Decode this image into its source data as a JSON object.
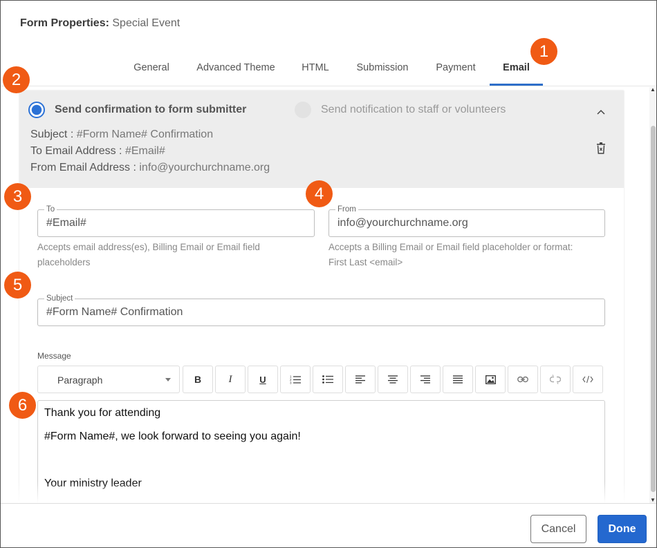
{
  "dialog": {
    "title_label": "Form Properties:",
    "title_name": "Special Event"
  },
  "tabs": [
    {
      "label": "General"
    },
    {
      "label": "Advanced Theme"
    },
    {
      "label": "HTML"
    },
    {
      "label": "Submission"
    },
    {
      "label": "Payment"
    },
    {
      "label": "Email",
      "active": true
    }
  ],
  "callouts": [
    "1",
    "2",
    "3",
    "4",
    "5",
    "6"
  ],
  "summary": {
    "option_selected": "Send confirmation to form submitter",
    "option_other": "Send notification to staff or volunteers",
    "subject_label": "Subject : ",
    "subject_value": "#Form Name# Confirmation",
    "to_label": "To Email Address : ",
    "to_value": "#Email#",
    "from_label": "From Email Address : ",
    "from_value": "info@yourchurchname.org"
  },
  "fields": {
    "to": {
      "label": "To",
      "value": "#Email#",
      "hint_line1": "Accepts email address(es), Billing Email or Email field",
      "hint_line2": "placeholders"
    },
    "from": {
      "label": "From",
      "value": "info@yourchurchname.org",
      "hint_line1": "Accepts a Billing Email or Email field placeholder or format:",
      "hint_line2": "First Last <email>"
    },
    "subject": {
      "label": "Subject",
      "value": "#Form Name# Confirmation"
    }
  },
  "message": {
    "label": "Message",
    "format_select": "Paragraph",
    "toolbar_icons": [
      "bold-icon",
      "italic-icon",
      "underline-icon",
      "ordered-list-icon",
      "bullet-list-icon",
      "align-left-icon",
      "align-center-icon",
      "align-right-icon",
      "align-justify-icon",
      "image-icon",
      "link-icon",
      "unlink-icon",
      "code-icon"
    ],
    "toolbar_text": {
      "bold": "B",
      "italic": "I",
      "underline": "U"
    },
    "lines": [
      "Thank you for attending",
      "#Form Name#, we look forward to seeing you again!",
      "Your ministry leader"
    ]
  },
  "footer": {
    "cancel_label": "Cancel",
    "done_label": "Done"
  },
  "colors": {
    "accent": "#2468cf",
    "callout": "#f05a14",
    "summary_bg": "#ededed"
  }
}
